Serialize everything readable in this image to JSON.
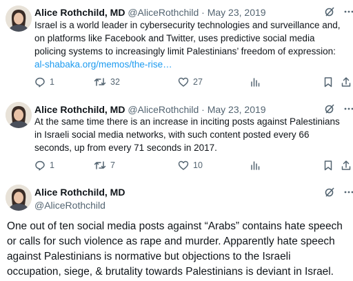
{
  "colors": {
    "text": "#0f1419",
    "muted": "#536471",
    "link": "#1d9bf0"
  },
  "tweets": [
    {
      "name": "Alice Rothchild, MD",
      "handle": "@AliceRothchild",
      "sep": "·",
      "date": "May 23, 2019",
      "lines": [
        "Israel  is a world leader in cybersecurity technologies and surveillance  and,",
        "on platforms like Facebook and Twitter, uses predictive social  media",
        "policing systems to increasingly limit Palestinians’ freedom of expression:"
      ],
      "link": "al-shabaka.org/memos/the-rise…",
      "replies": "1",
      "retweets": "32",
      "likes": "27",
      "icons": [
        "grok-icon",
        "more-icon",
        "reply-icon",
        "retweet-icon",
        "like-icon",
        "views-icon",
        "bookmark-icon",
        "share-icon"
      ]
    },
    {
      "name": "Alice Rothchild, MD",
      "handle": "@AliceRothchild",
      "sep": "·",
      "date": "May 23, 2019",
      "lines": [
        "At the same time there is an increase in inciting posts against  Palestinians",
        "in Israeli social media networks, with such content posted  every 66",
        "seconds, up from every 71 seconds in 2017."
      ],
      "replies": "1",
      "retweets": "7",
      "likes": "10"
    },
    {
      "name": "Alice Rothchild, MD",
      "handle": "@AliceRothchild",
      "lines": [
        "One out of ten social media posts against “Arabs” contains hate speech",
        "or calls for such  violence as rape and murder. Apparently hate speech",
        "against Palestinians is normative but objections  to the Israeli",
        "occupation, siege, & brutality towards Palestinians is deviant in Israel."
      ]
    }
  ]
}
